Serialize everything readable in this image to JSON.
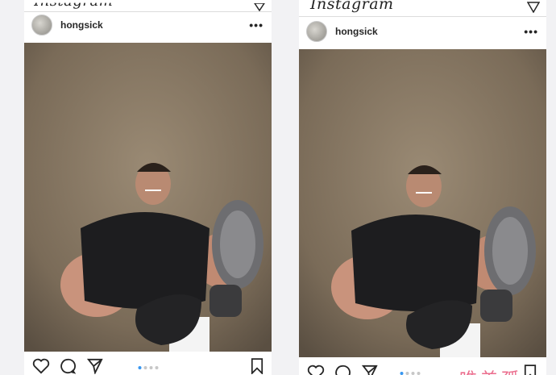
{
  "posts": [
    {
      "app_title": "Instagram",
      "username": "hongsick",
      "more": "•••",
      "carousel_dots": 4,
      "active_dot": 0
    },
    {
      "app_title": "Instagram",
      "username": "hongsick",
      "more": "•••",
      "carousel_dots": 4,
      "active_dot": 0,
      "watermark": "唯美孤"
    }
  ],
  "icons": {
    "like": "heart-icon",
    "comment": "comment-icon",
    "share": "send-icon",
    "save": "bookmark-icon"
  },
  "colors": {
    "dot_active": "#3897f0",
    "dot_inactive": "#c7c7c7",
    "watermark": "#e8547a"
  }
}
